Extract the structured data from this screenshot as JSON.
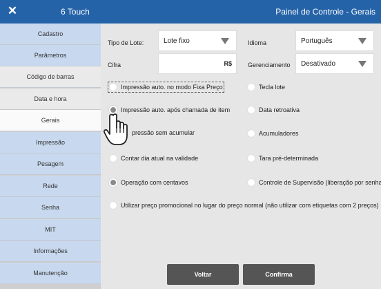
{
  "titlebar": {
    "close_glyph": "✕",
    "app_name": "6 Touch",
    "title": "Painel de Controle - Gerais"
  },
  "sidebar": {
    "items": [
      {
        "label": "Cadastro"
      },
      {
        "label": "Parâmetros"
      },
      {
        "label": "Código de barras"
      },
      {
        "label": "Data e hora"
      },
      {
        "label": "Gerais"
      },
      {
        "label": "Impressão"
      },
      {
        "label": "Pesagem"
      },
      {
        "label": "Rede"
      },
      {
        "label": "Senha"
      },
      {
        "label": "MIT"
      },
      {
        "label": "Informações"
      },
      {
        "label": "Manutenção"
      }
    ],
    "selected": "Gerais"
  },
  "form": {
    "tipo_lote": {
      "label": "Tipo de Lote:",
      "value": "Lote fixo"
    },
    "idioma": {
      "label": "Idioma",
      "value": "Português"
    },
    "cifra": {
      "label": "Cifra",
      "value": "",
      "currency": "R$"
    },
    "gerenciamento": {
      "label": "Gerenciamento",
      "value": "Desativado"
    }
  },
  "options": {
    "impressao_fixa_preco": {
      "label": "Impressão auto. no modo Fixa Preço",
      "checked": false
    },
    "tecla_lote": {
      "label": "Tecla lote",
      "checked": false
    },
    "impressao_chamada_item": {
      "label": "Impressão auto. após chamada de item",
      "checked": true
    },
    "data_retroativa": {
      "label": "Data retroativa",
      "checked": false
    },
    "impressao_sem_acumular": {
      "label": "pressão sem acumular",
      "checked": false
    },
    "acumuladores": {
      "label": "Acumuladores",
      "checked": false
    },
    "contar_dia_atual": {
      "label": "Contar dia atual na validade",
      "checked": false
    },
    "tara_predeterminada": {
      "label": "Tara pré-determinada",
      "checked": false
    },
    "operacao_centavos": {
      "label": "Operação com centavos",
      "checked": true
    },
    "controle_supervisao": {
      "label": "Controle de Supervisão (liberação por senha)",
      "checked": false
    },
    "preco_promocional": {
      "label": "Utilizar preço promocional no lugar do preço normal (não utilizar com etiquetas com 2 preços)",
      "checked": false
    }
  },
  "buttons": {
    "voltar": "Voltar",
    "confirma": "Confirma"
  },
  "colors": {
    "titlebar": "#2563a8",
    "sidebar_blue": "#c8d9ef",
    "button": "#555555"
  },
  "icons": {
    "close": "close-icon",
    "pointer": "hand-pointer-icon"
  }
}
